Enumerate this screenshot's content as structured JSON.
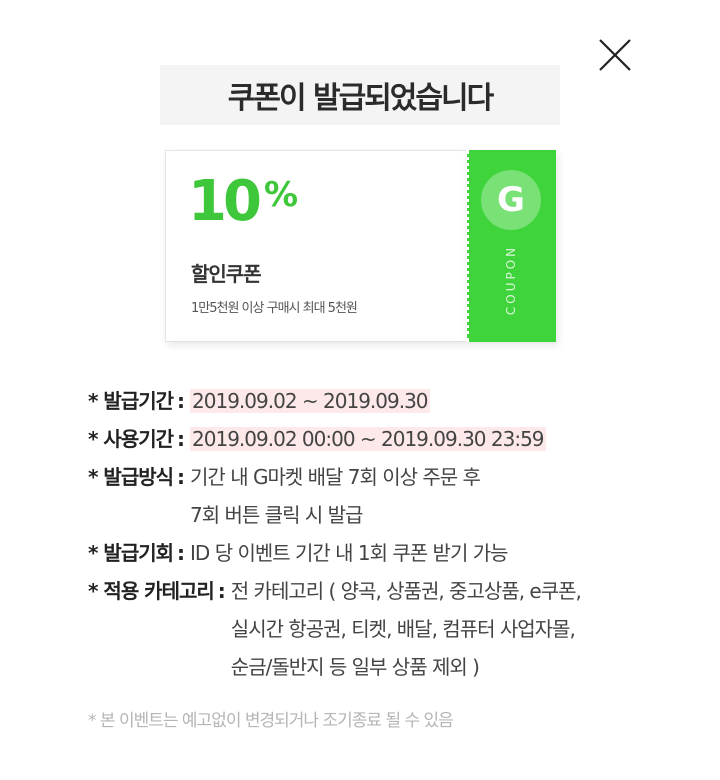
{
  "close_button": {
    "icon": "close-icon"
  },
  "title": "쿠폰이 발급되었습니다",
  "coupon": {
    "percent_number": "10",
    "percent_sign": "%",
    "name": "할인쿠폰",
    "condition": "1만5천원 이상 구매시 최대 5천원",
    "logo_letter": "G",
    "stub_label": "COUPON",
    "accent_color": "#3fd43b"
  },
  "info": {
    "issue_period": {
      "label": "* 발급기간",
      "value": "2019.09.02 ~ 2019.09.30"
    },
    "use_period": {
      "label": "* 사용기간",
      "value": "2019.09.02 00:00 ~ 2019.09.30 23:59"
    },
    "issue_method": {
      "label": "* 발급방식",
      "lines": [
        "기간 내 G마켓 배달 7회 이상 주문 후",
        "7회 버튼 클릭 시 발급"
      ]
    },
    "issue_count": {
      "label": "* 발급기회",
      "value": "ID 당 이벤트 기간 내 1회 쿠폰 받기 가능"
    },
    "category": {
      "label": "* 적용 카테고리",
      "lines": [
        "전 카테고리 ( 양곡, 상품권, 중고상품, e쿠폰,",
        "실시간 항공권, 티켓, 배달, 컴퓨터 사업자몰,",
        "순금/돌반지 등 일부 상품 제외 )"
      ]
    },
    "separator": ":"
  },
  "notice": "* 본 이벤트는 예고없이 변경되거나 조기종료 될 수 있음"
}
